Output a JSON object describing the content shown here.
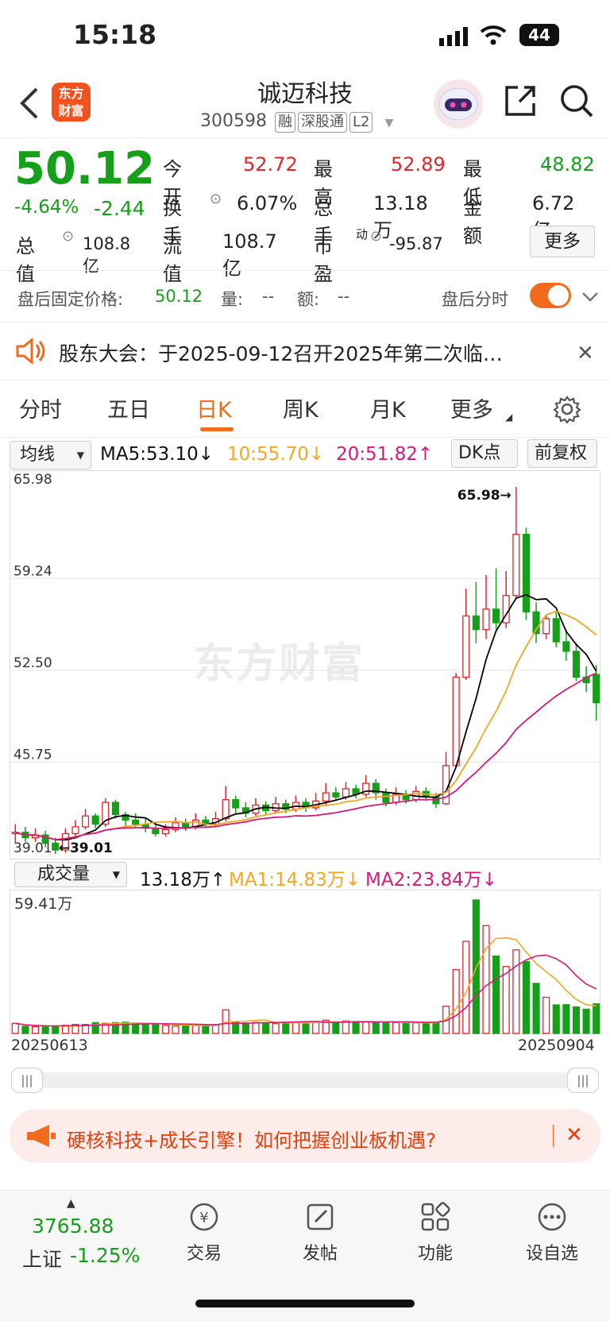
{
  "status_bar": {
    "time": "15:18",
    "battery": "44"
  },
  "header": {
    "title": "诚迈科技",
    "code": "300598",
    "tags": [
      "融",
      "深股通",
      "L2"
    ]
  },
  "quote": {
    "price": "50.12",
    "pct": "-4.64%",
    "chg": "-2.44",
    "open_label": "今开",
    "open": "52.72",
    "high_label": "最高",
    "high": "52.89",
    "low_label": "最低",
    "low": "48.82",
    "turnover_label": "换手",
    "turnover": "6.07%",
    "volume_label": "总手",
    "volume": "13.18万",
    "amount_label": "金额",
    "amount": "6.72亿",
    "mcap_label": "总值",
    "mcap": "108.8亿",
    "float_label": "流值",
    "float": "108.7亿",
    "pe_label": "市盈",
    "pe_sup": "动",
    "pe": "-95.87",
    "more": "更多"
  },
  "after_hours": {
    "label": "盘后固定价格:",
    "price": "50.12",
    "vol_label": "量:",
    "vol": "--",
    "amt_label": "额:",
    "amt": "--",
    "toggle_label": "盘后分时"
  },
  "notice": {
    "text": "股东大会：于2025-09-12召开2025年第二次临…"
  },
  "tabs": [
    "分时",
    "五日",
    "日K",
    "周K",
    "月K",
    "更多"
  ],
  "ma": {
    "selector": "均线",
    "ma5": "MA5:53.10↓",
    "ma10": "10:55.70↓",
    "ma20": "20:51.82↑",
    "dk": "DK点",
    "fq": "前复权"
  },
  "vol": {
    "selector": "成交量",
    "vol": "13.18万↑",
    "ma1": "MA1:14.83万↓",
    "ma2": "MA2:23.84万↓",
    "max": "59.41万"
  },
  "dates": {
    "start": "20250613",
    "end": "20250904"
  },
  "banner": {
    "text": "硬核科技+成长引擎！如何把握创业板机遇?"
  },
  "nav": {
    "index_value": "3765.88",
    "index_name": "上证",
    "index_pct": "-1.25%",
    "items": [
      "交易",
      "发帖",
      "功能",
      "设自选"
    ]
  },
  "chart_data": {
    "type": "candlestick",
    "y_ticks": [
      "65.98",
      "59.24",
      "52.50",
      "45.75",
      "39.01"
    ],
    "high_label": "65.98→",
    "low_label": "←39.01",
    "watermark": "东方财富",
    "ylim": [
      39.01,
      65.98
    ],
    "colors": {
      "up": "#e3242b",
      "down": "#16a01a",
      "ma5": "#000000",
      "ma10": "#f5a623",
      "ma20": "#d6197a"
    },
    "candles": [
      [
        40.5,
        40.6,
        41.2,
        39.8
      ],
      [
        40.6,
        40.2,
        41.0,
        39.9
      ],
      [
        40.2,
        40.4,
        40.9,
        39.9
      ],
      [
        40.4,
        39.8,
        40.7,
        39.5
      ],
      [
        39.8,
        39.3,
        40.2,
        39.0
      ],
      [
        39.3,
        40.5,
        40.9,
        39.1
      ],
      [
        40.5,
        41.0,
        41.5,
        40.2
      ],
      [
        41.0,
        41.8,
        42.3,
        40.8
      ],
      [
        41.8,
        41.2,
        42.0,
        40.9
      ],
      [
        41.2,
        42.8,
        43.1,
        41.0
      ],
      [
        42.8,
        41.9,
        43.0,
        41.6
      ],
      [
        41.9,
        41.5,
        42.1,
        41.0
      ],
      [
        41.5,
        41.2,
        42.0,
        41.0
      ],
      [
        41.2,
        40.9,
        41.6,
        40.6
      ],
      [
        40.9,
        40.5,
        41.4,
        40.3
      ],
      [
        40.5,
        40.8,
        41.2,
        40.3
      ],
      [
        40.8,
        41.3,
        41.7,
        40.6
      ],
      [
        41.3,
        41.0,
        41.6,
        40.7
      ],
      [
        41.0,
        41.5,
        42.0,
        40.8
      ],
      [
        41.5,
        41.2,
        41.8,
        40.9
      ],
      [
        41.2,
        41.6,
        42.1,
        41.0
      ],
      [
        41.6,
        43.0,
        44.0,
        41.4
      ],
      [
        43.0,
        42.4,
        43.3,
        42.0
      ],
      [
        42.4,
        42.0,
        42.8,
        41.7
      ],
      [
        42.0,
        42.6,
        43.1,
        41.8
      ],
      [
        42.6,
        42.2,
        42.9,
        41.9
      ],
      [
        42.2,
        42.7,
        43.2,
        42.0
      ],
      [
        42.7,
        42.3,
        43.0,
        42.0
      ],
      [
        42.3,
        42.8,
        43.3,
        42.1
      ],
      [
        42.8,
        42.4,
        43.1,
        42.1
      ],
      [
        42.4,
        42.9,
        43.5,
        42.2
      ],
      [
        42.9,
        43.5,
        44.2,
        42.6
      ],
      [
        43.5,
        43.2,
        43.9,
        42.9
      ],
      [
        43.2,
        43.8,
        44.3,
        43.0
      ],
      [
        43.8,
        43.4,
        44.1,
        43.1
      ],
      [
        43.4,
        44.2,
        44.8,
        43.2
      ],
      [
        44.2,
        43.5,
        44.5,
        43.0
      ],
      [
        43.5,
        42.8,
        43.8,
        42.5
      ],
      [
        42.8,
        43.4,
        43.9,
        42.6
      ],
      [
        43.4,
        43.0,
        43.7,
        42.7
      ],
      [
        43.0,
        43.6,
        44.0,
        42.8
      ],
      [
        43.6,
        43.2,
        43.9,
        42.9
      ],
      [
        43.2,
        42.7,
        43.5,
        42.4
      ],
      [
        42.7,
        45.5,
        46.5,
        42.6
      ],
      [
        45.5,
        52.0,
        52.3,
        45.3
      ],
      [
        52.0,
        56.5,
        58.5,
        51.8
      ],
      [
        56.5,
        55.5,
        59.0,
        54.5
      ],
      [
        55.5,
        57.0,
        59.5,
        54.8
      ],
      [
        57.0,
        56.0,
        60.0,
        55.5
      ],
      [
        56.0,
        58.0,
        59.8,
        55.6
      ],
      [
        58.0,
        62.5,
        65.98,
        57.8
      ],
      [
        62.5,
        56.8,
        63.0,
        56.2
      ],
      [
        56.8,
        55.2,
        57.5,
        54.5
      ],
      [
        55.2,
        56.3,
        56.6,
        54.8
      ],
      [
        56.3,
        54.6,
        56.8,
        54.2
      ],
      [
        54.6,
        53.9,
        55.5,
        53.2
      ],
      [
        53.9,
        52.0,
        54.5,
        51.7
      ],
      [
        52.0,
        51.6,
        52.8,
        50.9
      ],
      [
        52.2,
        50.12,
        52.89,
        48.82
      ]
    ],
    "volumes": [
      4.5,
      3.2,
      3.0,
      2.9,
      3.2,
      3.6,
      4.0,
      4.0,
      4.8,
      4.5,
      4.8,
      5.0,
      4.4,
      4.2,
      3.8,
      3.6,
      3.3,
      3.6,
      3.8,
      3.2,
      3.9,
      10.5,
      5.1,
      4.7,
      4.9,
      4.8,
      4.4,
      4.9,
      4.9,
      4.4,
      5.3,
      5.9,
      5.2,
      5.6,
      5.2,
      5.3,
      4.9,
      4.8,
      4.8,
      4.8,
      4.7,
      4.6,
      4.9,
      12.1,
      28.4,
      41.0,
      59.41,
      48.0,
      34.5,
      29.8,
      37.2,
      32.0,
      22.3,
      16.1,
      12.7,
      12.8,
      11.8,
      10.8,
      13.18
    ]
  }
}
